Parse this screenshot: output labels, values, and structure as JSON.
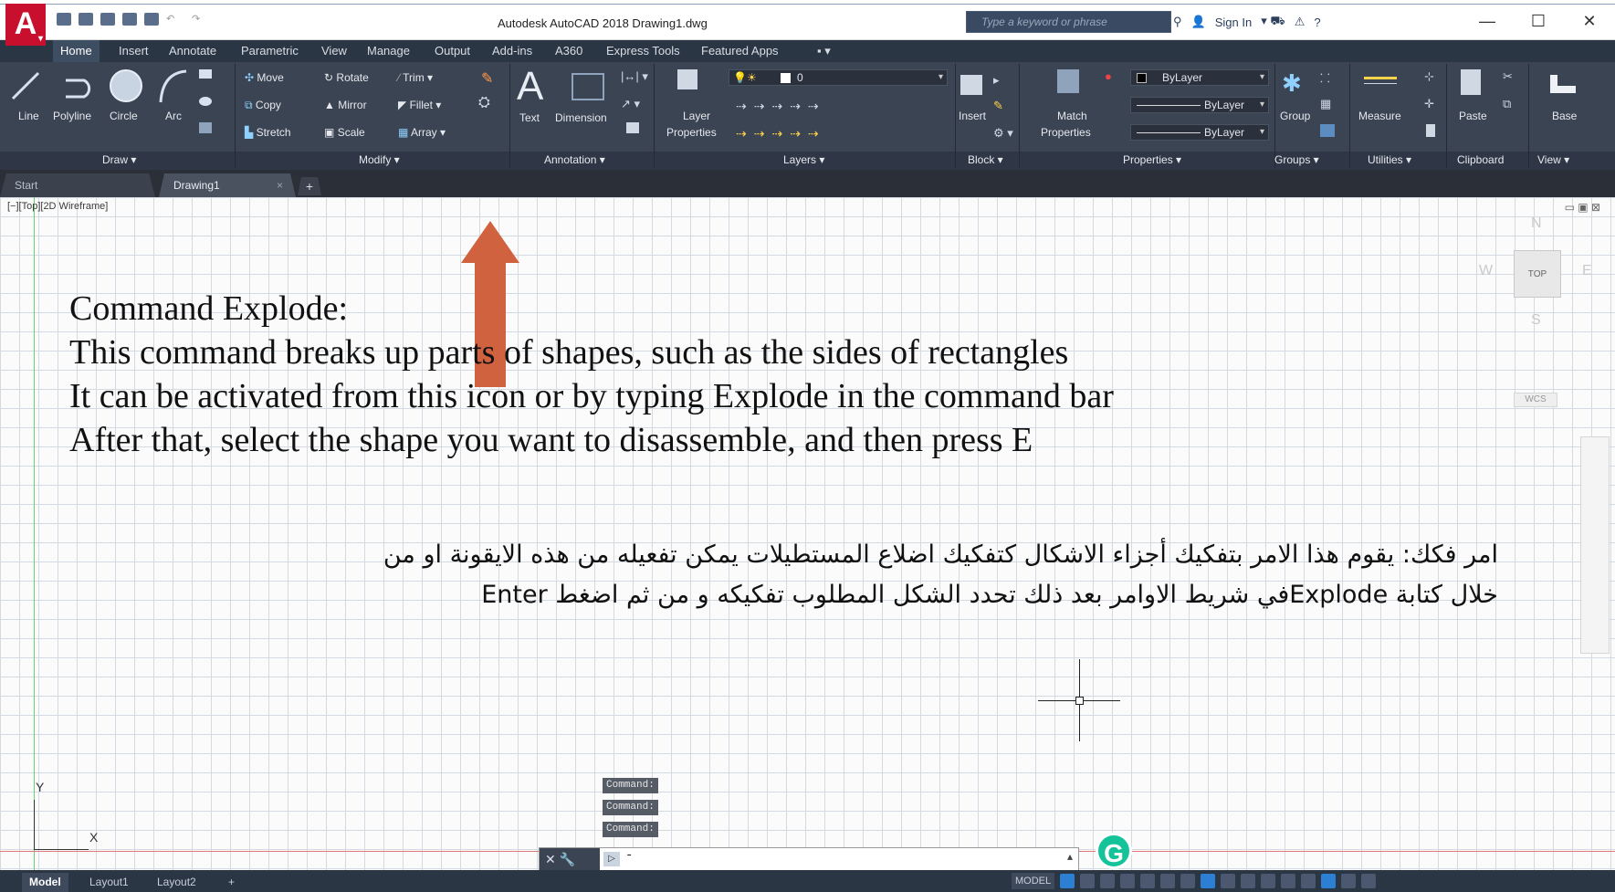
{
  "titlebar": {
    "app_logo": "A",
    "title": "Autodesk AutoCAD 2018    Drawing1.dwg",
    "search_placeholder": "Type a keyword or phrase",
    "sign_in": "Sign In"
  },
  "ribbon_tabs": [
    "Home",
    "Insert",
    "Annotate",
    "Parametric",
    "View",
    "Manage",
    "Output",
    "Add-ins",
    "A360",
    "Express Tools",
    "Featured Apps"
  ],
  "draw": {
    "line": "Line",
    "polyline": "Polyline",
    "circle": "Circle",
    "arc": "Arc",
    "panel": "Draw ▾"
  },
  "modify": {
    "move": "Move",
    "rotate": "Rotate",
    "trim": "Trim",
    "copy": "Copy",
    "mirror": "Mirror",
    "fillet": "Fillet",
    "stretch": "Stretch",
    "scale": "Scale",
    "array": "Array",
    "panel": "Modify ▾"
  },
  "annotation": {
    "text": "Text",
    "dimension": "Dimension",
    "panel": "Annotation ▾"
  },
  "layers": {
    "layer_properties_1": "Layer",
    "layer_properties_2": "Properties",
    "current_layer": "0",
    "panel": "Layers ▾"
  },
  "block": {
    "insert": "Insert",
    "panel": "Block ▾"
  },
  "properties": {
    "match_1": "Match",
    "match_2": "Properties",
    "color": "ByLayer",
    "linetype": "ByLayer",
    "lineweight": "ByLayer",
    "panel": "Properties ▾"
  },
  "groups": {
    "group": "Group",
    "panel": "Groups ▾"
  },
  "utilities": {
    "measure": "Measure",
    "panel": "Utilities ▾"
  },
  "clipboard": {
    "paste": "Paste",
    "panel": "Clipboard"
  },
  "view_panel": {
    "base": "Base",
    "panel": "View ▾"
  },
  "file_tabs": {
    "start": "Start",
    "drawing": "Drawing1",
    "close": "×",
    "add": "+"
  },
  "viewport": {
    "label": "[−][Top][2D Wireframe]",
    "controls": "▭ ▣ ⊠"
  },
  "viewcube": {
    "top": "TOP",
    "n": "N",
    "w": "W",
    "e": "E",
    "s": "S",
    "wcs": "WCS"
  },
  "annotation_text": {
    "line1": "Command Explode:",
    "line2": "This command breaks up parts of shapes, such as the sides of rectangles",
    "line3": "It can be activated from this icon or by typing Explode in the command bar",
    "line4": "After that, select the shape you want to disassemble, and then press E",
    "arabic1": "امر فكك: يقوم هذا الامر بتفكيك أجزاء الاشكال كتفكيك اضلاع المستطيلات يمكن تفعيله من هذه الايقونة او من",
    "arabic2": "خلال كتابة Explodeفي شريط الاوامر بعد ذلك تحدد الشكل المطلوب تفكيكه و من ثم اضغط Enter"
  },
  "ucs": {
    "y": "Y",
    "x": "X"
  },
  "command_history": [
    "Command:",
    "Command:",
    "Command:"
  ],
  "command_line": {
    "prompt_icon": "▷",
    "value": "-"
  },
  "status_tabs": [
    "Model",
    "Layout1",
    "Layout2",
    "+"
  ],
  "status_model": "MODEL",
  "colors": {
    "ribbon_bg": "#3b4453",
    "tab_bg": "#2b3645",
    "arrow": "#d0623f",
    "logo": "#c8102e",
    "grammarly": "#15c39a"
  }
}
